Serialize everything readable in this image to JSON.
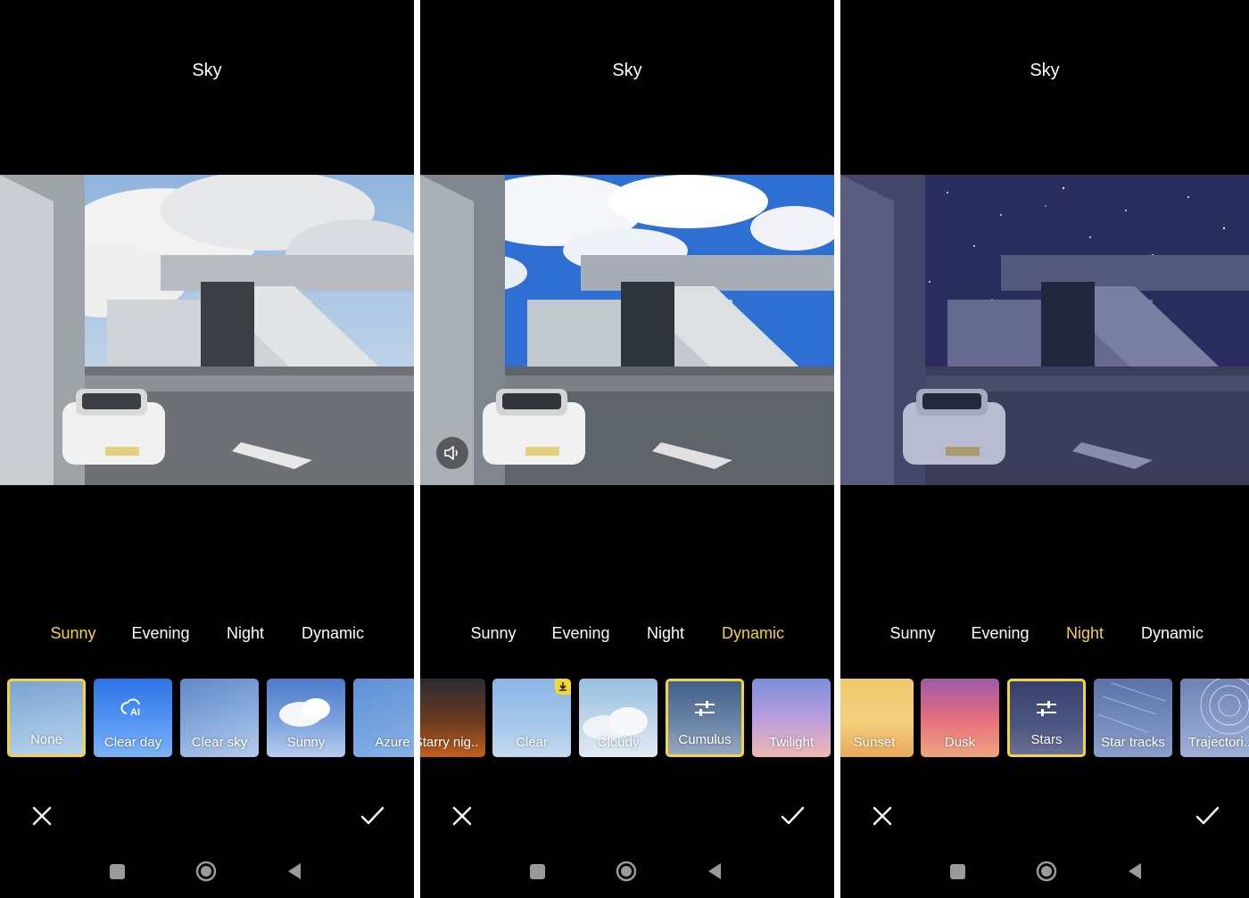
{
  "screens": [
    {
      "title": "Sky",
      "categories": [
        "Sunny",
        "Evening",
        "Night",
        "Dynamic"
      ],
      "active_category": "Sunny",
      "sky_variant": "cloudy-day",
      "thumbnails": [
        {
          "label": "None",
          "selected": true
        },
        {
          "label": "Clear day",
          "selected": false,
          "icon": "ai-cloud-icon"
        },
        {
          "label": "Clear sky",
          "selected": false
        },
        {
          "label": "Sunny",
          "selected": false
        },
        {
          "label": "Azure",
          "selected": false
        }
      ]
    },
    {
      "title": "Sky",
      "categories": [
        "Sunny",
        "Evening",
        "Night",
        "Dynamic"
      ],
      "active_category": "Dynamic",
      "sky_variant": "blue-cumulus",
      "sound_button_icon": "speaker-icon",
      "thumbnails": [
        {
          "label": "Starry nig..",
          "selected": false
        },
        {
          "label": "Clear",
          "selected": false,
          "badge": "download-icon"
        },
        {
          "label": "Cloudy",
          "selected": false
        },
        {
          "label": "Cumulus",
          "selected": true,
          "icon": "sliders-icon"
        },
        {
          "label": "Twilight",
          "selected": false
        }
      ]
    },
    {
      "title": "Sky",
      "categories": [
        "Sunny",
        "Evening",
        "Night",
        "Dynamic"
      ],
      "active_category": "Night",
      "sky_variant": "starry-night",
      "thumbnails": [
        {
          "label": "Sunset",
          "selected": false
        },
        {
          "label": "Dusk",
          "selected": false
        },
        {
          "label": "Stars",
          "selected": true,
          "icon": "sliders-icon"
        },
        {
          "label": "Star tracks",
          "selected": false
        },
        {
          "label": "Trajectori..",
          "selected": false
        }
      ]
    }
  ],
  "colors": {
    "accent": "#f5d33a",
    "background": "#000000",
    "text": "#ffffff"
  }
}
